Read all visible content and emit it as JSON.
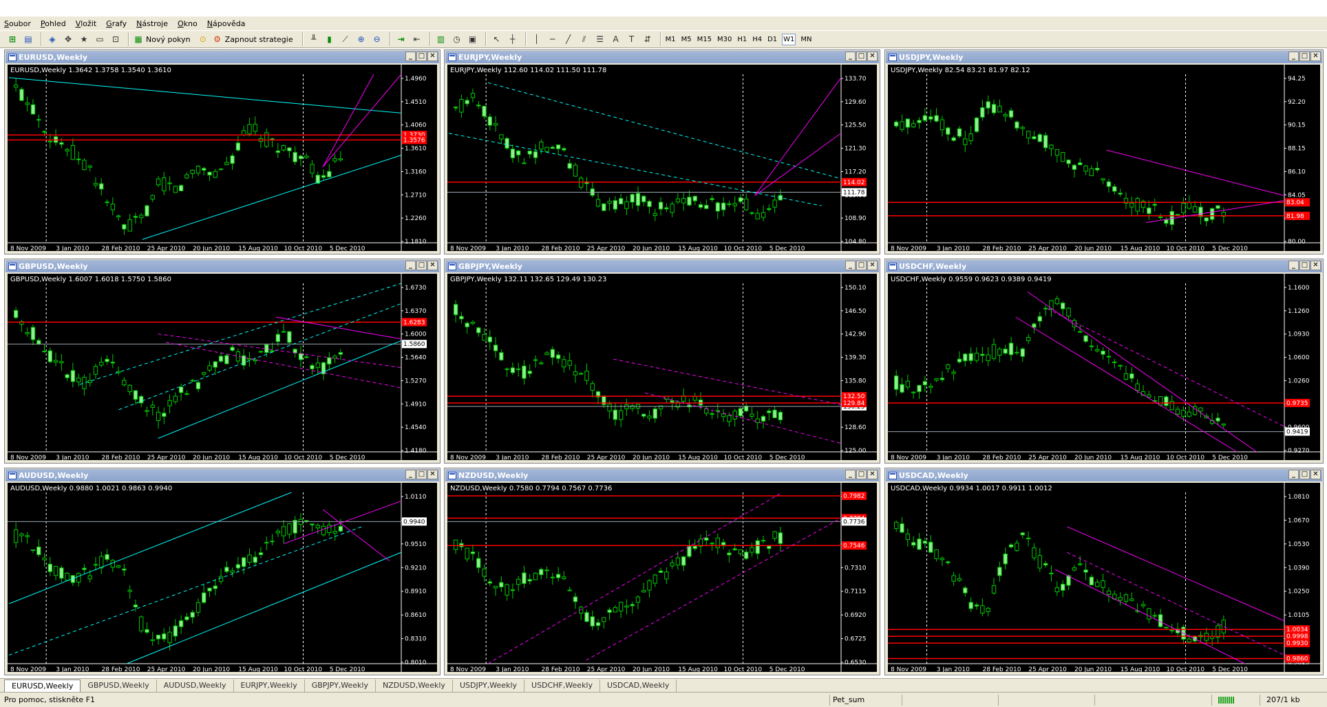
{
  "menu": [
    "Soubor",
    "Pohled",
    "Vložit",
    "Grafy",
    "Nástroje",
    "Okno",
    "Nápověda"
  ],
  "toolbar": {
    "new_order_label": "Nový pokyn",
    "strategy_label": "Zapnout strategie",
    "timeframes": [
      "M1",
      "M5",
      "M15",
      "M30",
      "H1",
      "H4",
      "D1",
      "W1",
      "MN"
    ],
    "active_timeframe": "W1"
  },
  "colors": {
    "bull_candle": "#90ee90",
    "bear_candle": "#000000",
    "wick": "#00cc00",
    "red_level": "#ff0000",
    "cyan_line": "#00ffff",
    "magenta_line": "#ff00ff",
    "window_title": "#8ba3cc"
  },
  "charts": [
    {
      "title": "EURUSD,Weekly",
      "info": "EURUSD,Weekly  1.3642 1.3758 1.3540 1.3610",
      "y_ticks": [
        "1.4960",
        "1.4510",
        "1.4060",
        "1.3610",
        "1.3160",
        "1.2710",
        "1.2260",
        "1.1810"
      ],
      "ymin": 1.181,
      "ymax": 1.53,
      "price_tags": [
        {
          "text": "1.3730",
          "color": "red"
        },
        {
          "text": "1.3576",
          "color": "red"
        }
      ],
      "dates": [
        "8 Nov 2009",
        "3 Jan 2010",
        "28 Feb 2010",
        "25 Apr 2010",
        "20 Jun 2010",
        "15 Aug 2010",
        "10 Oct 2010",
        "5 Dec 2010"
      ]
    },
    {
      "title": "EURJPY,Weekly",
      "info": "EURJPY,Weekly  112.60 114.02 111.50 111.78",
      "y_ticks": [
        "133.70",
        "129.60",
        "125.50",
        "121.30",
        "117.20",
        "113.00",
        "108.90",
        "104.80"
      ],
      "ymin": 104.8,
      "ymax": 136.0,
      "price_tags": [
        {
          "text": "114.02",
          "color": "red"
        },
        {
          "text": "111.78",
          "color": "white"
        }
      ],
      "dates": [
        "8 Nov 2009",
        "3 Jan 2010",
        "28 Feb 2010",
        "25 Apr 2010",
        "20 Jun 2010",
        "15 Aug 2010",
        "10 Oct 2010",
        "5 Dec 2010"
      ]
    },
    {
      "title": "USDJPY,Weekly",
      "info": "USDJPY,Weekly  82.54 83.21 81.97 82.12",
      "y_ticks": [
        "94.25",
        "92.20",
        "90.15",
        "88.15",
        "86.10",
        "84.05",
        "82.00",
        "80.00"
      ],
      "ymin": 80.0,
      "ymax": 95.6,
      "price_tags": [
        {
          "text": "83.04",
          "color": "red"
        },
        {
          "text": "81.98",
          "color": "red"
        }
      ],
      "dates": [
        "8 Nov 2009",
        "3 Jan 2010",
        "28 Feb 2010",
        "25 Apr 2010",
        "20 Jun 2010",
        "15 Aug 2010",
        "10 Oct 2010",
        "5 Dec 2010"
      ]
    },
    {
      "title": "GBPUSD,Weekly",
      "info": "GBPUSD,Weekly  1.6007 1.6018 1.5750 1.5860",
      "y_ticks": [
        "1.6730",
        "1.6370",
        "1.6000",
        "1.5640",
        "1.5270",
        "1.4910",
        "1.4540",
        "1.4180"
      ],
      "ymin": 1.418,
      "ymax": 1.7,
      "price_tags": [
        {
          "text": "1.6283",
          "color": "red"
        },
        {
          "text": "1.5860",
          "color": "white"
        }
      ],
      "dates": [
        "8 Nov 2009",
        "3 Jan 2010",
        "28 Feb 2010",
        "25 Apr 2010",
        "20 Jun 2010",
        "15 Aug 2010",
        "10 Oct 2010",
        "5 Dec 2010"
      ]
    },
    {
      "title": "GBPJPY,Weekly",
      "info": "GBPJPY,Weekly  132.11 132.65 129.49 130.23",
      "y_ticks": [
        "150.10",
        "146.50",
        "142.90",
        "139.30",
        "135.80",
        "132.20",
        "128.60",
        "125.00"
      ],
      "ymin": 125.0,
      "ymax": 153.0,
      "price_tags": [
        {
          "text": "132.50",
          "color": "red"
        },
        {
          "text": "130.23",
          "color": "white"
        },
        {
          "text": "129.84",
          "color": "red"
        }
      ],
      "dates": [
        "8 Nov 2009",
        "3 Jan 2010",
        "28 Feb 2010",
        "25 Apr 2010",
        "20 Jun 2010",
        "15 Aug 2010",
        "10 Oct 2010",
        "5 Dec 2010"
      ]
    },
    {
      "title": "USDCHF,Weekly",
      "info": "USDCHF,Weekly  0.9559 0.9623 0.9389 0.9419",
      "y_ticks": [
        "1.1600",
        "1.1260",
        "1.0930",
        "1.0600",
        "1.0260",
        "0.9930",
        "0.9600",
        "0.9270"
      ],
      "ymin": 0.927,
      "ymax": 1.185,
      "price_tags": [
        {
          "text": "0.9735",
          "color": "red"
        },
        {
          "text": "0.9419",
          "color": "white"
        }
      ],
      "dates": [
        "8 Nov 2009",
        "3 Jan 2010",
        "28 Feb 2010",
        "25 Apr 2010",
        "20 Jun 2010",
        "15 Aug 2010",
        "10 Oct 2010",
        "5 Dec 2010"
      ]
    },
    {
      "title": "AUDUSD,Weekly",
      "info": "AUDUSD,Weekly  0.9880 1.0021 0.9863 0.9940",
      "y_ticks": [
        "1.0110",
        "0.9810",
        "0.9510",
        "0.9210",
        "0.8910",
        "0.8610",
        "0.8310",
        "0.8010"
      ],
      "ymin": 0.801,
      "ymax": 1.032,
      "price_tags": [
        {
          "text": "0.9940",
          "color": "white"
        }
      ],
      "dates": [
        "8 Nov 2009",
        "3 Jan 2010",
        "28 Feb 2010",
        "25 Apr 2010",
        "20 Jun 2010",
        "15 Aug 2010",
        "10 Oct 2010",
        "5 Dec 2010"
      ]
    },
    {
      "title": "NZDUSD,Weekly",
      "info": "NZDUSD,Weekly  0.7580 0.7794 0.7567 0.7736",
      "y_ticks": [
        "0.7900",
        "0.7700",
        "0.7505",
        "0.7310",
        "0.7115",
        "0.6920",
        "0.6725",
        "0.6530"
      ],
      "ymin": 0.653,
      "ymax": 0.803,
      "price_tags": [
        {
          "text": "0.7982",
          "color": "red"
        },
        {
          "text": "0.7784",
          "color": "red"
        },
        {
          "text": "0.7736",
          "color": "white"
        },
        {
          "text": "0.7546",
          "color": "red"
        }
      ],
      "dates": [
        "8 Nov 2009",
        "3 Jan 2010",
        "28 Feb 2010",
        "25 Apr 2010",
        "20 Jun 2010",
        "15 Aug 2010",
        "10 Oct 2010",
        "5 Dec 2010"
      ]
    },
    {
      "title": "USDCAD,Weekly",
      "info": "USDCAD,Weekly  0.9934 1.0017 0.9911 1.0012",
      "y_ticks": [
        "1.0810",
        "1.0670",
        "1.0530",
        "1.0390",
        "1.0250",
        "1.0105",
        "0.9965",
        "0.9825"
      ],
      "ymin": 0.9825,
      "ymax": 1.093,
      "price_tags": [
        {
          "text": "1.0034",
          "color": "red"
        },
        {
          "text": "0.9998",
          "color": "red"
        },
        {
          "text": "0.9930",
          "color": "red"
        },
        {
          "text": "0.9860",
          "color": "red"
        }
      ],
      "dates": [
        "8 Nov 2009",
        "3 Jan 2010",
        "28 Feb 2010",
        "25 Apr 2010",
        "20 Jun 2010",
        "15 Aug 2010",
        "10 Oct 2010",
        "5 Dec 2010"
      ]
    }
  ],
  "tabs": [
    "EURUSD,Weekly",
    "GBPUSD,Weekly",
    "AUDUSD,Weekly",
    "EURJPY,Weekly",
    "GBPJPY,Weekly",
    "NZDUSD,Weekly",
    "USDJPY,Weekly",
    "USDCHF,Weekly",
    "USDCAD,Weekly"
  ],
  "active_tab": "EURUSD,Weekly",
  "status": {
    "help": "Pro pomoc, stiskněte F1",
    "profile": "Pet_sum",
    "traffic": "207/1 kb"
  }
}
